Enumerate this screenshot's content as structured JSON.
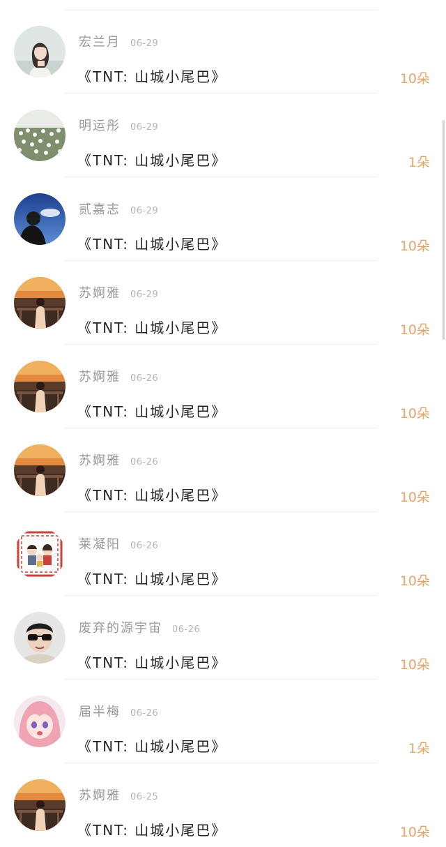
{
  "supporters": [
    {
      "name": "宏兰月",
      "date": "06-29",
      "title": "《TNT: 山城小尾巴》",
      "count": "10朵",
      "avatar": "girl-portrait"
    },
    {
      "name": "明运彤",
      "date": "06-29",
      "title": "《TNT: 山城小尾巴》",
      "count": "1朵",
      "avatar": "flower-field"
    },
    {
      "name": "贰嘉志",
      "date": "06-29",
      "title": "《TNT: 山城小尾巴》",
      "count": "10朵",
      "avatar": "blue-sky-girl"
    },
    {
      "name": "苏婀雅",
      "date": "06-29",
      "title": "《TNT: 山城小尾巴》",
      "count": "10朵",
      "avatar": "sunset-girl"
    },
    {
      "name": "苏婀雅",
      "date": "06-26",
      "title": "《TNT: 山城小尾巴》",
      "count": "10朵",
      "avatar": "sunset-girl"
    },
    {
      "name": "苏婀雅",
      "date": "06-26",
      "title": "《TNT: 山城小尾巴》",
      "count": "10朵",
      "avatar": "sunset-girl"
    },
    {
      "name": "莱凝阳",
      "date": "06-26",
      "title": "《TNT: 山城小尾巴》",
      "count": "10朵",
      "avatar": "cartoon-family"
    },
    {
      "name": "废弃的源宇宙",
      "date": "06-26",
      "title": "《TNT: 山城小尾巴》",
      "count": "10朵",
      "avatar": "sunglasses-guy"
    },
    {
      "name": "届半梅",
      "date": "06-26",
      "title": "《TNT: 山城小尾巴》",
      "count": "1朵",
      "avatar": "anime-girl"
    },
    {
      "name": "苏婀雅",
      "date": "06-25",
      "title": "《TNT: 山城小尾巴》",
      "count": "10朵",
      "avatar": "sunset-girl"
    }
  ],
  "colors": {
    "count": "#e8a56a",
    "name": "#9a9a9a",
    "date": "#b5b5b5",
    "title": "#222222",
    "divider": "#f0f0f0"
  }
}
